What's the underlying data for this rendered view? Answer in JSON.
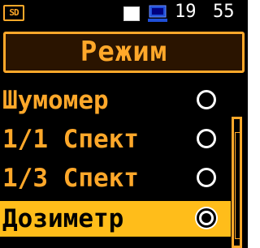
{
  "status_bar": {
    "sd_label": "SD",
    "clock_hours": "19",
    "clock_minutes": "55"
  },
  "title": "Режим",
  "menu": [
    {
      "label": "Шумомер",
      "selected": false
    },
    {
      "label": "1/1 Спект",
      "selected": false
    },
    {
      "label": "1/3 Спект",
      "selected": false
    },
    {
      "label": "Дозиметр",
      "selected": true
    }
  ],
  "colors": {
    "accent": "#ffa82a",
    "selected_background": "#ffbd1a",
    "background": "#000000"
  },
  "icons": [
    "sd-card-icon",
    "battery-icon",
    "computer-connection-icon"
  ]
}
